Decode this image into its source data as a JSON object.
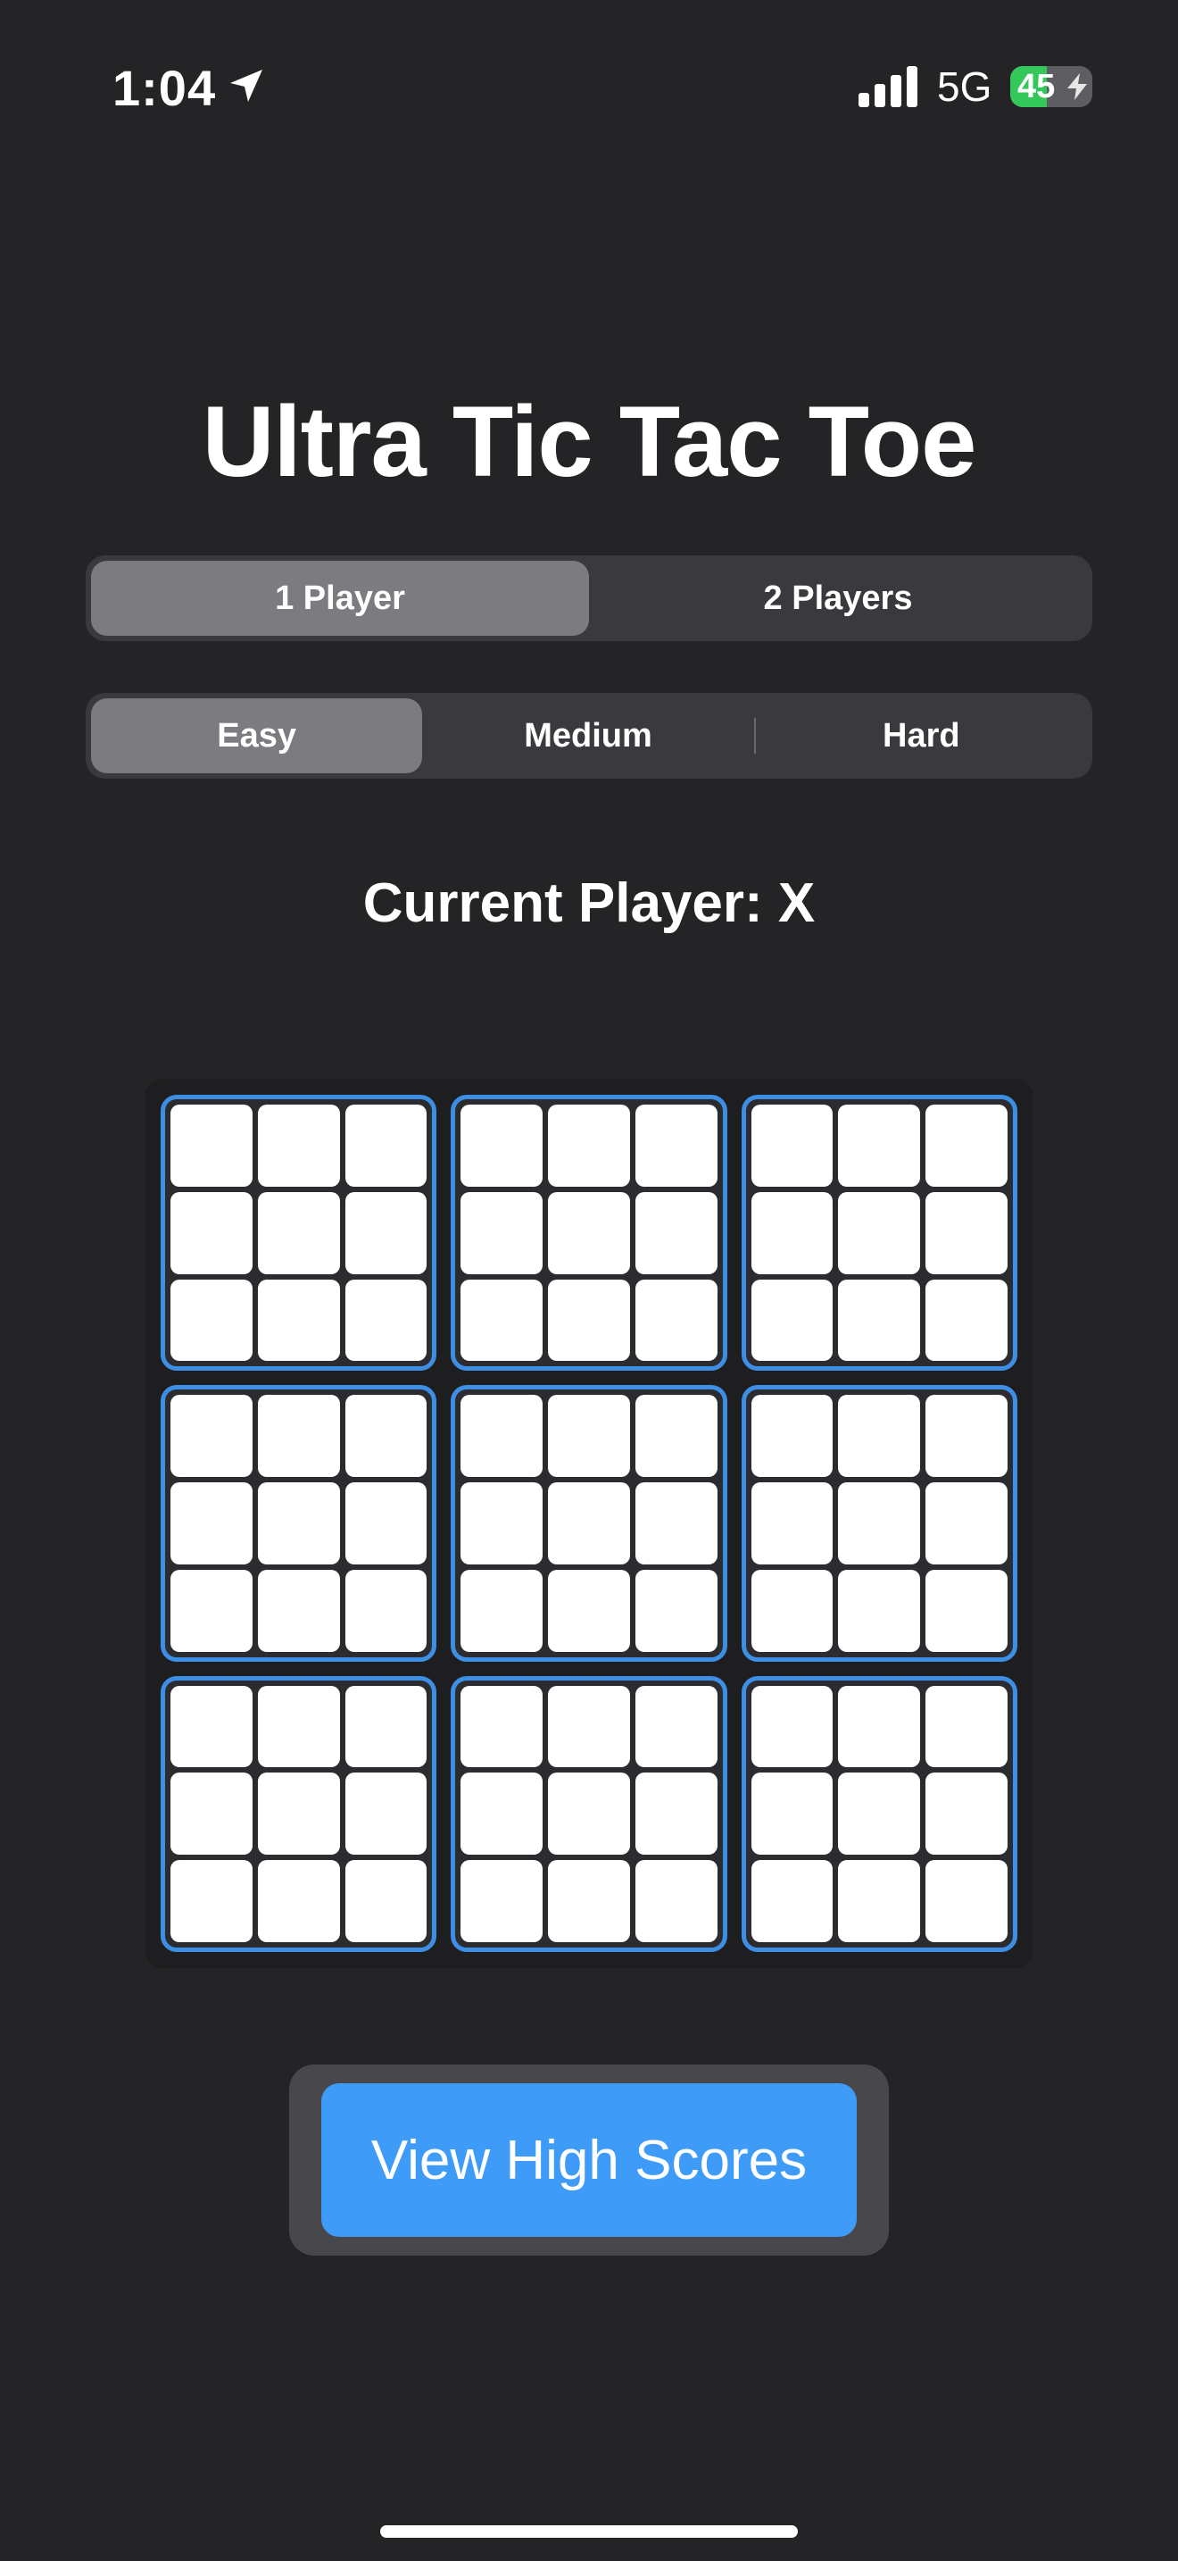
{
  "status_bar": {
    "time": "1:04",
    "network": "5G",
    "battery_percent": "45",
    "battery_level": 0.45,
    "icons": [
      "location-arrow-icon",
      "cellular-signal-icon",
      "battery-charging-icon"
    ]
  },
  "title": "Ultra Tic Tac Toe",
  "player_mode": {
    "options": [
      {
        "label": "1 Player",
        "selected": true
      },
      {
        "label": "2 Players",
        "selected": false
      }
    ]
  },
  "difficulty": {
    "options": [
      {
        "label": "Easy",
        "selected": true
      },
      {
        "label": "Medium",
        "selected": false
      },
      {
        "label": "Hard",
        "selected": false
      }
    ]
  },
  "current_player": "Current Player: X",
  "board": {
    "sub_boards": 9,
    "cells_per_sub_board": 9,
    "cell_values": [
      [
        "",
        "",
        "",
        "",
        "",
        "",
        "",
        "",
        ""
      ],
      [
        "",
        "",
        "",
        "",
        "",
        "",
        "",
        "",
        ""
      ],
      [
        "",
        "",
        "",
        "",
        "",
        "",
        "",
        "",
        ""
      ],
      [
        "",
        "",
        "",
        "",
        "",
        "",
        "",
        "",
        ""
      ],
      [
        "",
        "",
        "",
        "",
        "",
        "",
        "",
        "",
        ""
      ],
      [
        "",
        "",
        "",
        "",
        "",
        "",
        "",
        "",
        ""
      ],
      [
        "",
        "",
        "",
        "",
        "",
        "",
        "",
        "",
        ""
      ],
      [
        "",
        "",
        "",
        "",
        "",
        "",
        "",
        "",
        ""
      ],
      [
        "",
        "",
        "",
        "",
        "",
        "",
        "",
        "",
        ""
      ]
    ]
  },
  "high_scores_button": "View High Scores",
  "colors": {
    "background": "#242426",
    "accent_blue": "#3f9bf8",
    "sub_board_border": "#3d8fe6",
    "battery_green": "#34c759",
    "segment_selected": "#7b7b80"
  }
}
